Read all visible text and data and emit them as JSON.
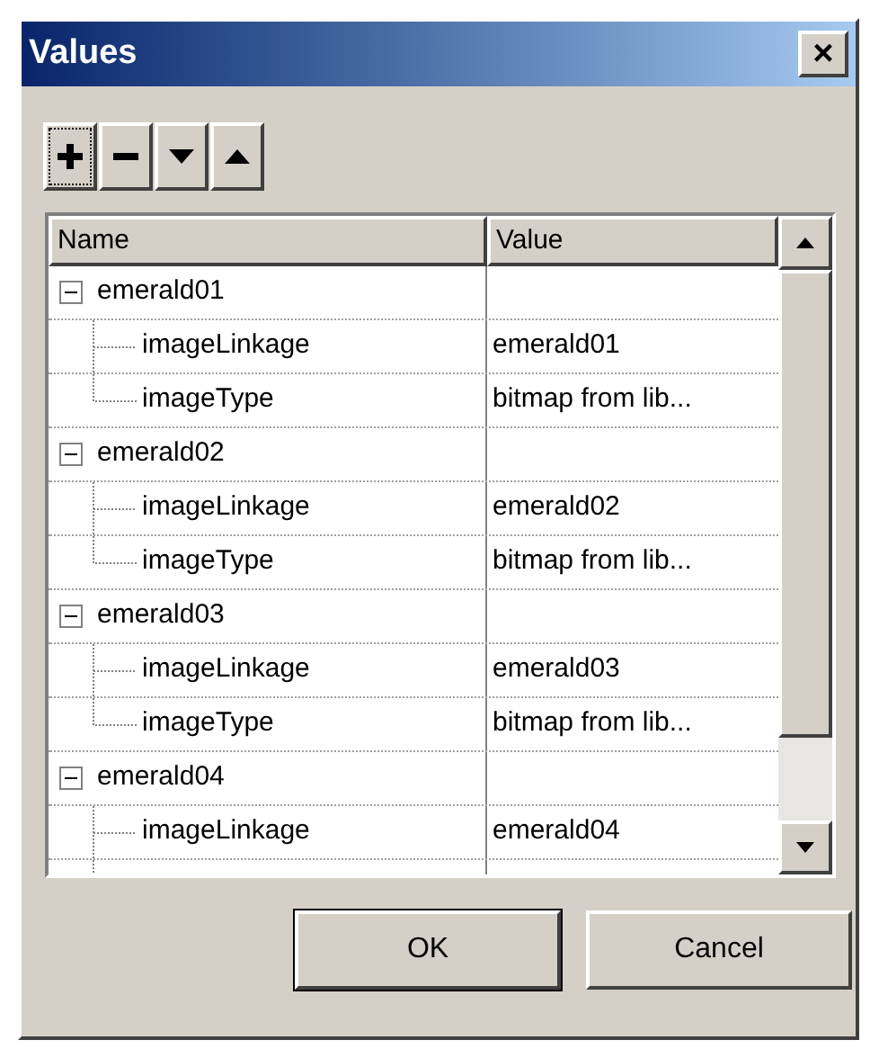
{
  "window": {
    "title": "Values",
    "close": "×"
  },
  "toolbar": [
    {
      "kind": "add",
      "focused": true
    },
    {
      "kind": "remove",
      "focused": false
    },
    {
      "kind": "down",
      "focused": false
    },
    {
      "kind": "up",
      "focused": false
    }
  ],
  "table": {
    "columns": [
      "Name",
      "Value"
    ],
    "rows": [
      {
        "name": "emerald01",
        "value": "",
        "expanded": true,
        "children": [
          {
            "name": "imageLinkage",
            "value": "emerald01"
          },
          {
            "name": "imageType",
            "value": "bitmap from lib..."
          }
        ]
      },
      {
        "name": "emerald02",
        "value": "",
        "expanded": true,
        "children": [
          {
            "name": "imageLinkage",
            "value": "emerald02"
          },
          {
            "name": "imageType",
            "value": "bitmap from lib..."
          }
        ]
      },
      {
        "name": "emerald03",
        "value": "",
        "expanded": true,
        "children": [
          {
            "name": "imageLinkage",
            "value": "emerald03"
          },
          {
            "name": "imageType",
            "value": "bitmap from lib..."
          }
        ]
      },
      {
        "name": "emerald04",
        "value": "",
        "expanded": true,
        "children": [
          {
            "name": "imageLinkage",
            "value": "emerald04"
          }
        ]
      }
    ]
  },
  "buttons": [
    {
      "label": "OK",
      "default": true
    },
    {
      "label": "Cancel",
      "default": false
    }
  ]
}
